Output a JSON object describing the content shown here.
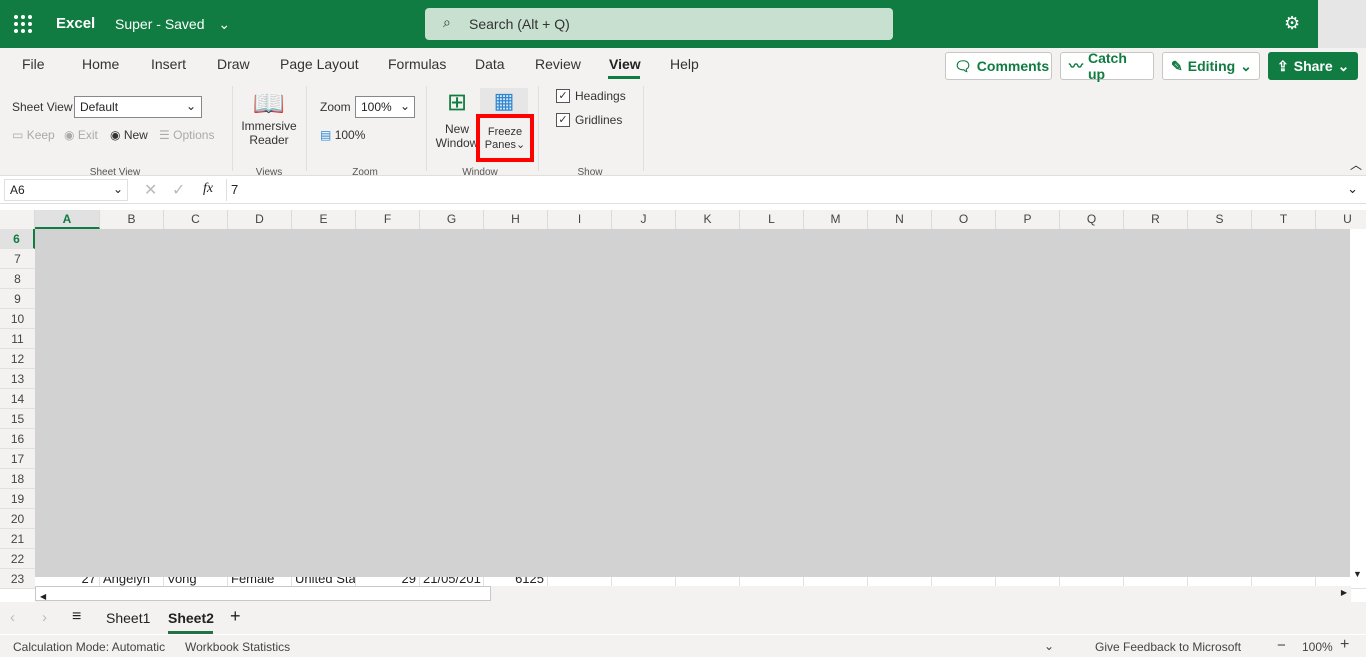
{
  "app": {
    "name": "Excel",
    "doc_title": "Super",
    "save_status": "Saved",
    "search_placeholder": "Search (Alt + Q)"
  },
  "ribbon_tabs": [
    "File",
    "Home",
    "Insert",
    "Draw",
    "Page Layout",
    "Formulas",
    "Data",
    "Review",
    "View",
    "Help"
  ],
  "active_tab": "View",
  "top_buttons": {
    "comments": "Comments",
    "catchup": "Catch up",
    "editing": "Editing",
    "share": "Share"
  },
  "sheet_view": {
    "label": "Sheet View",
    "value": "Default",
    "keep": "Keep",
    "exit": "Exit",
    "new": "New",
    "options": "Options",
    "group": "Sheet View"
  },
  "views": {
    "immersive1": "Immersive",
    "immersive2": "Reader",
    "group": "Views"
  },
  "zoom": {
    "label": "Zoom",
    "value": "100%",
    "reset": "100%",
    "group": "Zoom"
  },
  "window": {
    "new1": "New",
    "new2": "Window",
    "freeze1": "Freeze",
    "freeze2": "Panes",
    "group": "Window"
  },
  "show": {
    "headings": "Headings",
    "gridlines": "Gridlines",
    "group": "Show",
    "headings_checked": true,
    "gridlines_checked": true
  },
  "formula_bar": {
    "name_box": "A6",
    "formula": "7"
  },
  "columns": [
    "A",
    "B",
    "C",
    "D",
    "E",
    "F",
    "G",
    "H",
    "I",
    "J",
    "K",
    "L",
    "M",
    "N",
    "O",
    "P",
    "Q",
    "R",
    "S",
    "T",
    "U"
  ],
  "rows": [
    "6",
    "7",
    "8",
    "9",
    "10",
    "11",
    "12",
    "13",
    "14",
    "15",
    "16",
    "17",
    "18",
    "19",
    "20",
    "21",
    "22",
    "23"
  ],
  "row23": [
    "27",
    "Angelyn",
    "Vong",
    "Female",
    "United Sta",
    "29",
    "21/05/201",
    "6125"
  ],
  "sheets": [
    "Sheet1",
    "Sheet2"
  ],
  "active_sheet": "Sheet2",
  "status": {
    "calc": "Calculation Mode: Automatic",
    "stats": "Workbook Statistics",
    "feedback": "Give Feedback to Microsoft",
    "zoom": "100%"
  },
  "colors": {
    "brand": "#107c41",
    "highlight": "#ff0000",
    "overlay": "#d2d2d2"
  }
}
